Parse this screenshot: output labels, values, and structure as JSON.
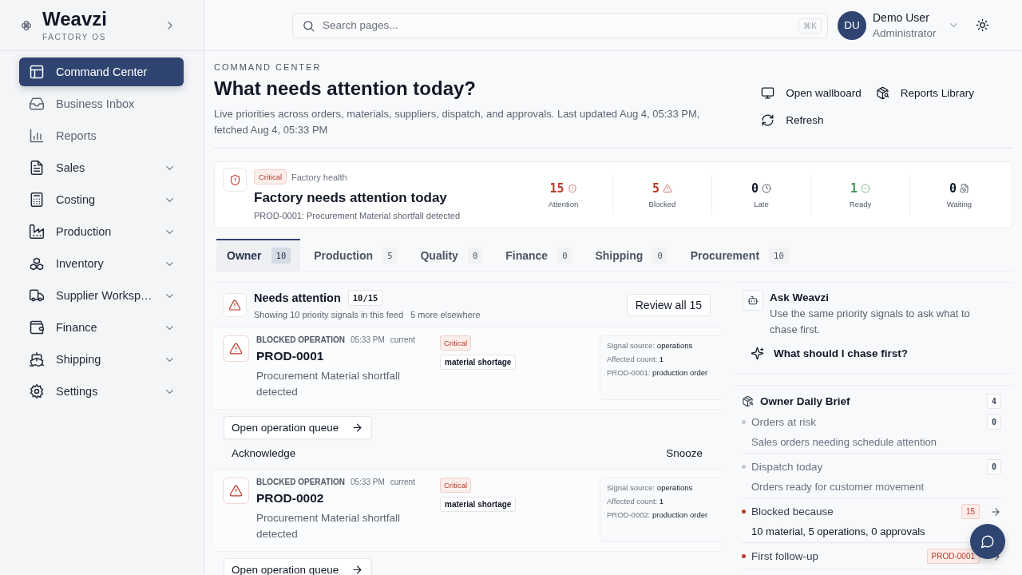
{
  "brand": {
    "name": "Weavzi",
    "tagline": "FACTORY OS"
  },
  "sidebar": {
    "items": [
      {
        "label": "Command Center",
        "kind": "link",
        "selected": true
      },
      {
        "label": "Business Inbox",
        "kind": "link",
        "selected": false
      },
      {
        "label": "Reports",
        "kind": "link",
        "selected": false
      },
      {
        "label": "Sales",
        "kind": "group",
        "selected": false,
        "expanded": false
      },
      {
        "label": "Costing",
        "kind": "group",
        "selected": false,
        "expanded": false
      },
      {
        "label": "Production",
        "kind": "group",
        "selected": false,
        "expanded": false
      },
      {
        "label": "Inventory",
        "kind": "group",
        "selected": false,
        "expanded": false
      },
      {
        "label": "Supplier Worksp…",
        "kind": "group",
        "selected": false,
        "expanded": false
      },
      {
        "label": "Finance",
        "kind": "group",
        "selected": false,
        "expanded": false
      },
      {
        "label": "Shipping",
        "kind": "group",
        "selected": false,
        "expanded": false
      },
      {
        "label": "Settings",
        "kind": "group",
        "selected": false,
        "expanded": false
      }
    ]
  },
  "search": {
    "placeholder": "Search pages...",
    "shortcut": "⌘K"
  },
  "user": {
    "initials": "DU",
    "name": "Demo User",
    "role": "Administrator"
  },
  "header": {
    "eyebrow": "COMMAND CENTER",
    "title": "What needs attention today?",
    "description": "Live priorities across orders, materials, suppliers, dispatch, and approvals. Last updated Aug 4, 05:33 PM, fetched Aug 4, 05:33 PM",
    "actions": [
      "Open wallboard",
      "Reports Library",
      "Refresh"
    ]
  },
  "health": {
    "severity": "Critical",
    "label": "Factory health",
    "title": "Factory needs attention today",
    "subtitle": "PROD-0001: Procurement Material shortfall detected",
    "stats": [
      {
        "value": "15",
        "label": "Attention",
        "color": "#c0392b"
      },
      {
        "value": "5",
        "label": "Blocked",
        "color": "#c0392b"
      },
      {
        "value": "0",
        "label": "Late",
        "color": "#111827"
      },
      {
        "value": "1",
        "label": "Ready",
        "color": "#3f9b5c"
      },
      {
        "value": "0",
        "label": "Waiting",
        "color": "#111827"
      }
    ]
  },
  "tabs": [
    {
      "label": "Owner",
      "count": "10",
      "selected": true
    },
    {
      "label": "Production",
      "count": "5",
      "selected": false
    },
    {
      "label": "Quality",
      "count": "0",
      "selected": false
    },
    {
      "label": "Finance",
      "count": "0",
      "selected": false
    },
    {
      "label": "Shipping",
      "count": "0",
      "selected": false
    },
    {
      "label": "Procurement",
      "count": "10",
      "selected": false
    }
  ],
  "feed": {
    "title": "Needs attention",
    "count": "10/15",
    "summary": "Showing 10 priority signals in this feed",
    "more": "5 more elsewhere",
    "review_button": "Review all 15",
    "signals": [
      {
        "type": "BLOCKED OPERATION",
        "time": "05:33 PM",
        "status": "current",
        "id": "PROD-0001",
        "description": "Procurement Material shortfall detected",
        "severity": "Critical",
        "tag": "material shortage",
        "details": [
          {
            "label": "Signal source:",
            "value": "operations"
          },
          {
            "label": "Affected count:",
            "value": "1"
          },
          {
            "label": "PROD-0001:",
            "value": "production order"
          }
        ],
        "actions": [
          {
            "label": "Open operation queue",
            "kind": "primary"
          },
          {
            "label": "Acknowledge",
            "kind": "plain"
          },
          {
            "label": "Snooze",
            "kind": "plain"
          }
        ]
      },
      {
        "type": "BLOCKED OPERATION",
        "time": "05:33 PM",
        "status": "current",
        "id": "PROD-0002",
        "description": "Procurement Material shortfall detected",
        "severity": "Critical",
        "tag": "material shortage",
        "details": [
          {
            "label": "Signal source:",
            "value": "operations"
          },
          {
            "label": "Affected count:",
            "value": "1"
          },
          {
            "label": "PROD-0002:",
            "value": "production order"
          }
        ],
        "actions": [
          {
            "label": "Open operation queue",
            "kind": "primary"
          }
        ]
      }
    ]
  },
  "ask": {
    "title": "Ask Weavzi",
    "description": "Use the same priority signals to ask what to chase first.",
    "prompt": "What should I chase first?"
  },
  "brief": {
    "title": "Owner Daily Brief",
    "count": "4",
    "items": [
      {
        "title": "Orders at risk",
        "detail": "Sales orders needing schedule attention",
        "count": "0",
        "color": "#c4c7cc",
        "alert": false
      },
      {
        "title": "Dispatch today",
        "detail": "Orders ready for customer movement",
        "count": "0",
        "color": "#c4c7cc",
        "alert": false
      },
      {
        "title": "Blocked because",
        "detail": "10 material, 5 operations, 0 approvals",
        "count": "15",
        "color": "#c0392b",
        "alert": true
      },
      {
        "title": "First follow-up",
        "count": "PROD-0001",
        "color": "#c0392b",
        "alert": true
      }
    ]
  }
}
